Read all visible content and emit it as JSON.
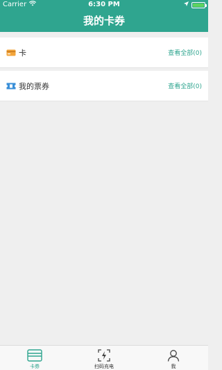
{
  "status_bar": {
    "carrier": "Carrier",
    "time": "6:30 PM"
  },
  "nav": {
    "title": "我的卡券"
  },
  "list": [
    {
      "label": "卡",
      "action": "查看全部(0)",
      "icon": "card-icon"
    },
    {
      "label": "我的票券",
      "action": "查看全部(0)",
      "icon": "ticket-icon"
    }
  ],
  "tabbar": {
    "items": [
      {
        "label": "卡券",
        "icon": "card-coupon-icon",
        "active": true
      },
      {
        "label": "扫码充电",
        "icon": "scan-charge-icon",
        "active": false
      },
      {
        "label": "我",
        "icon": "user-icon",
        "active": false
      }
    ]
  },
  "colors": {
    "accent": "#2fa58f",
    "background": "#efefef"
  }
}
